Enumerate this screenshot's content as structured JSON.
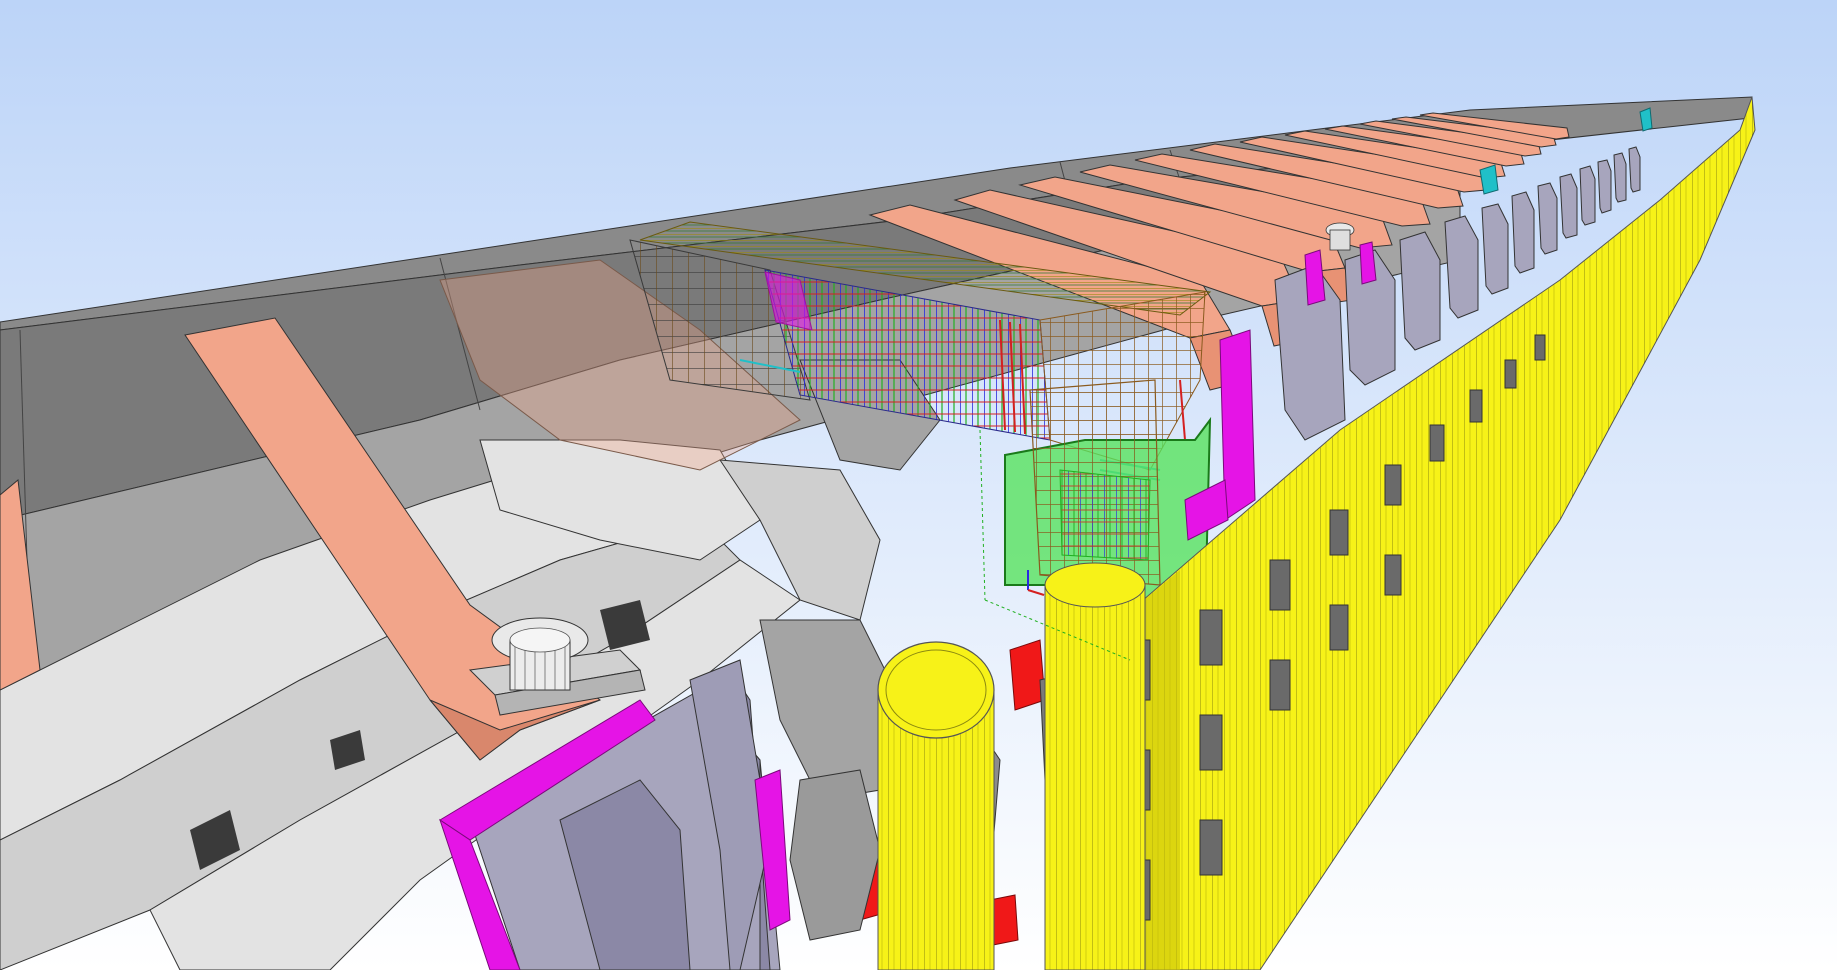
{
  "viewport": {
    "kind": "3d-model-view",
    "render_mode": "shaded-with-edges"
  },
  "colors": {
    "sky_top": "#bcd4f8",
    "sky_bottom": "#ffffff",
    "deck_top_face": "#8a8a8a",
    "deck_inner_face": "#7a7a7a",
    "slab_light": "#e3e3e3",
    "slab_mid": "#cfcfcf",
    "slab_dark": "#a4a4a4",
    "beam_salmon": "#f2a58a",
    "beam_salmon_dark": "#d9876c",
    "pile_yellow": "#f7f218",
    "pile_yellow_dark": "#c9c30a",
    "connector_magenta": "#e514e6",
    "bracket_lilac": "#a7a5bd",
    "bracket_lilac_dark": "#8b88a6",
    "selection_green": "#57e25e",
    "rebar_brown": "#8a5a1e",
    "rebar_blue": "#2a2ae0",
    "rebar_green": "#20b020",
    "rebar_red": "#d42020",
    "rebar_cyan": "#20c0c8",
    "highlight_red": "#f01818"
  }
}
